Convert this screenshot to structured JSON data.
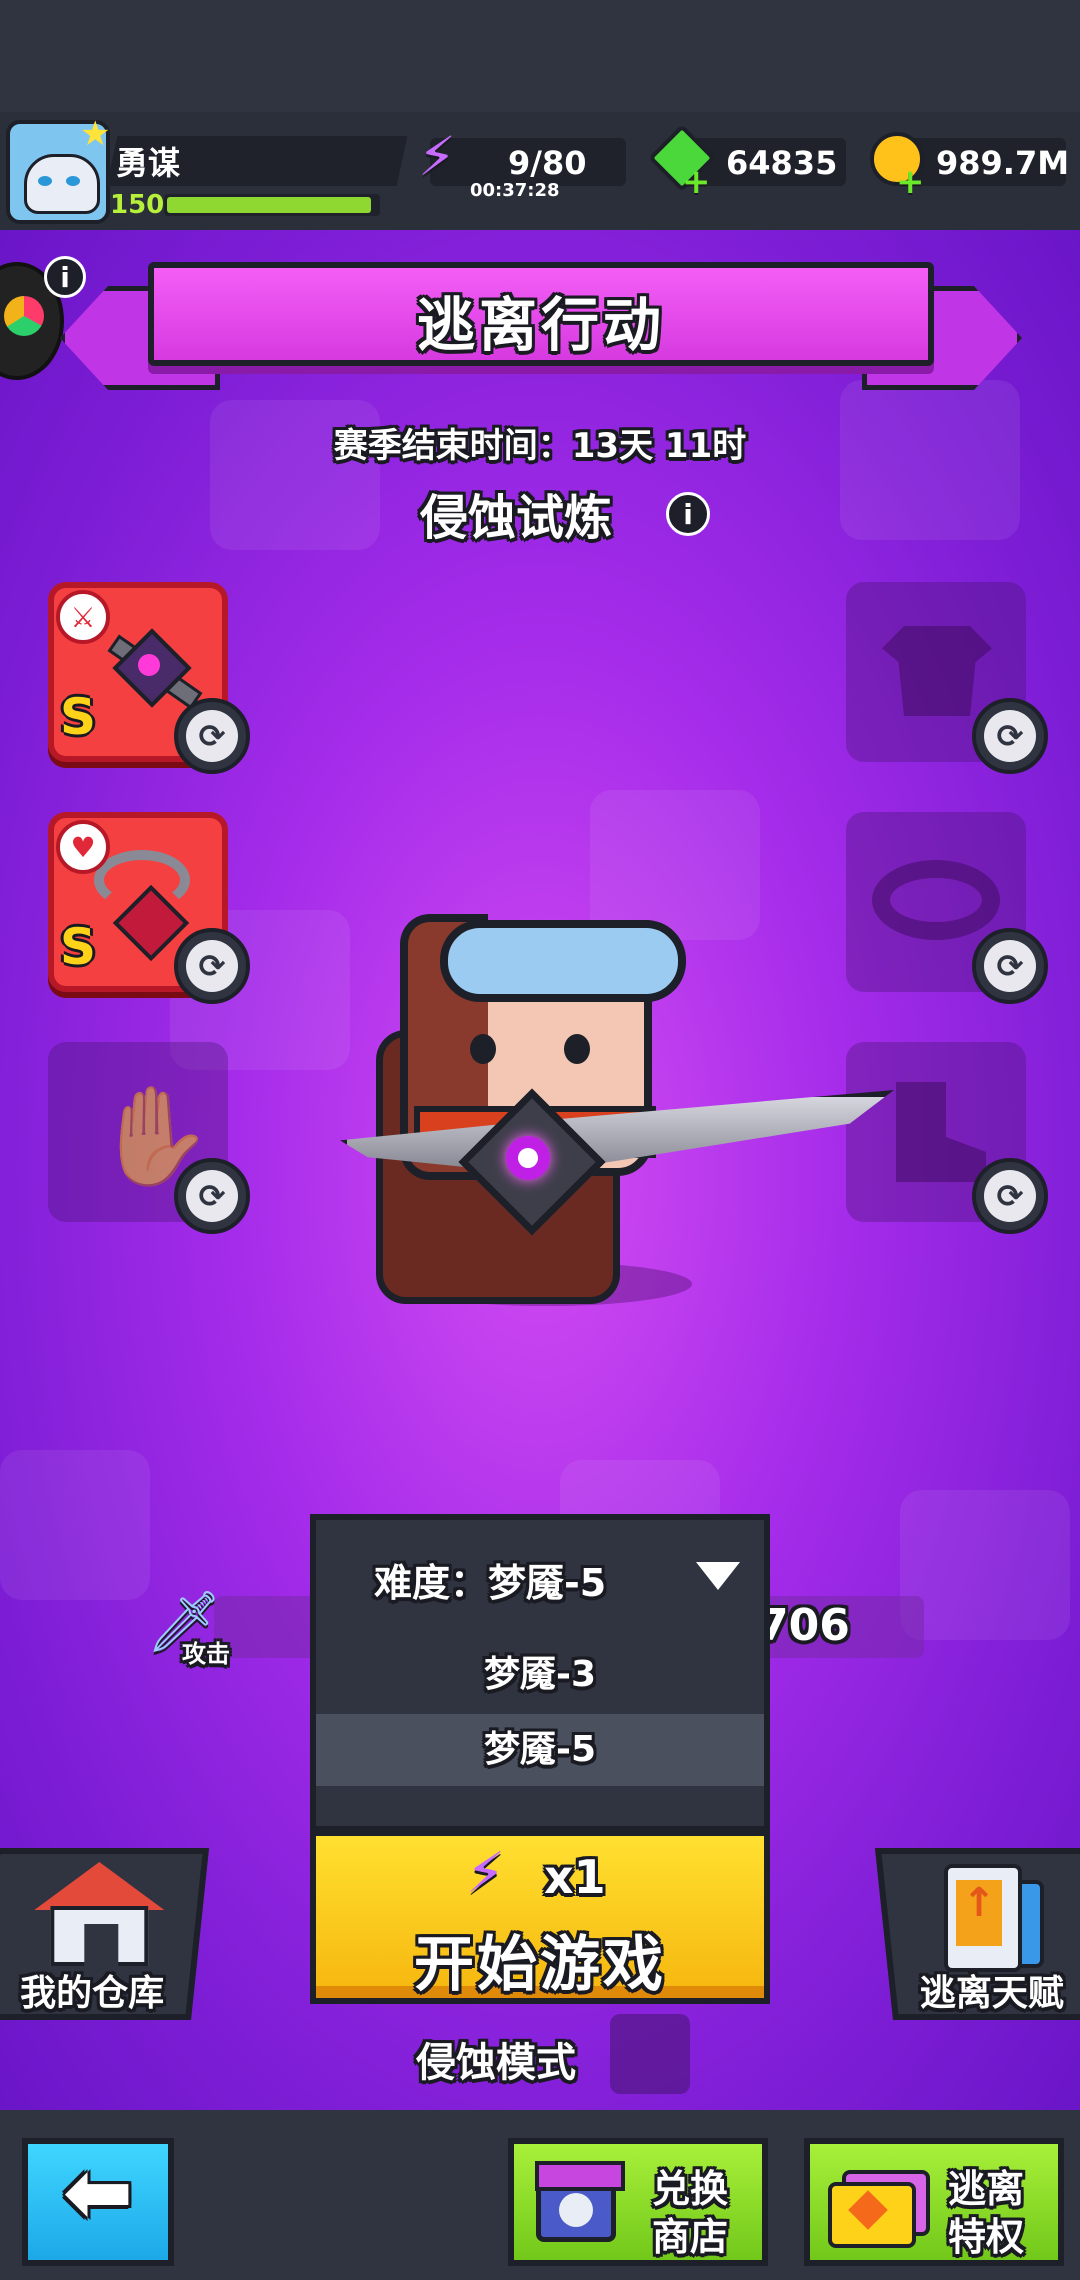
{
  "player": {
    "name": "勇谋",
    "level": "150",
    "exp_fraction": 0.97
  },
  "resources": {
    "energy": "9/80",
    "energy_timer": "00:37:28",
    "gems": "64835",
    "gold": "989.7M"
  },
  "event": {
    "title": "逃离行动",
    "season_end": "赛季结束时间：13天 11时",
    "mode_title": "侵蚀试炼"
  },
  "equipment": {
    "left": [
      {
        "name": "weapon",
        "grade": "S"
      },
      {
        "name": "necklace",
        "grade": "S"
      }
    ]
  },
  "stats": {
    "attack_label": "攻击",
    "power_partial": "706"
  },
  "difficulty": {
    "label": "难度：梦魇-5",
    "options": [
      "梦魇-3",
      "梦魇-5"
    ],
    "selected": "梦魇-5"
  },
  "start": {
    "cost": "x1",
    "label": "开始游戏"
  },
  "mode_toggle_label": "侵蚀模式",
  "side_buttons": {
    "warehouse": "我的仓库",
    "talent": "逃离天赋"
  },
  "bottom_nav": {
    "exchange_line1": "兑换",
    "exchange_line2": "商店",
    "privilege_line1": "逃离",
    "privilege_line2": "特权"
  },
  "colors": {
    "accent_yellow": "#ffd21a",
    "nav_green": "#8ee020",
    "back_blue": "#25c3f5",
    "slot_red": "#f44040",
    "title_pink": "#e43ee8"
  }
}
